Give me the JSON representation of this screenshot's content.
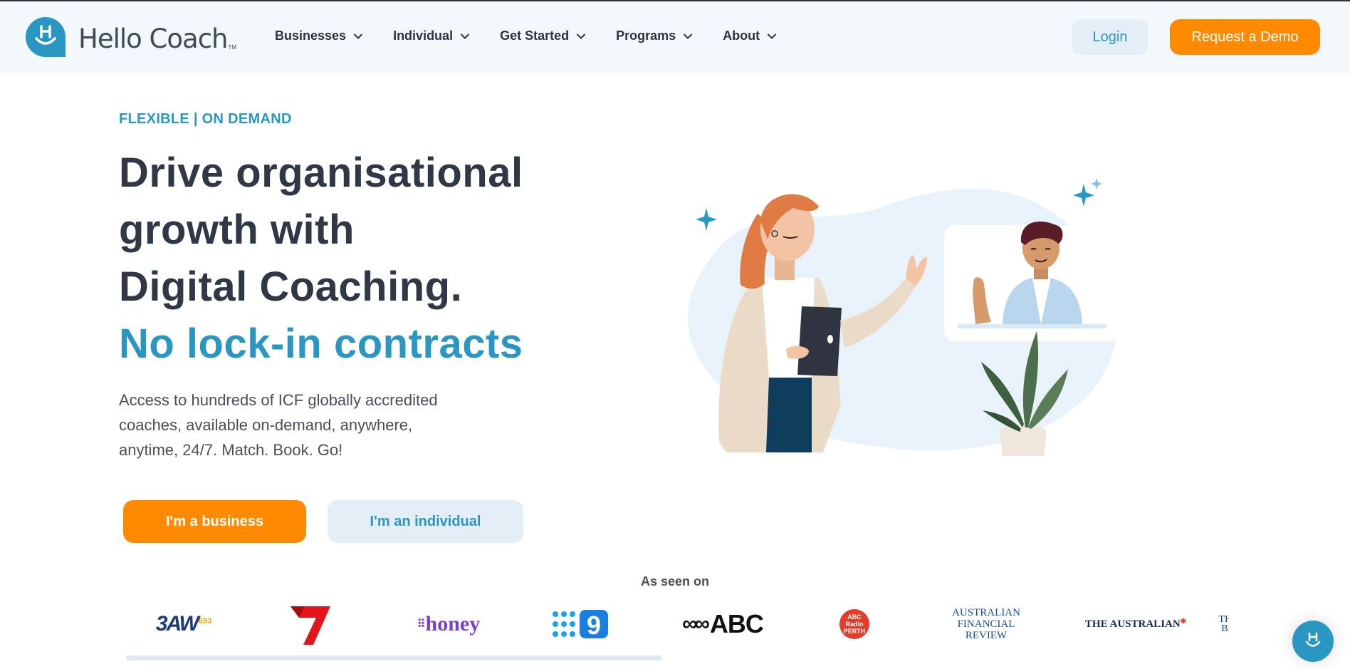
{
  "brand": {
    "name": "Hello Coach",
    "trademark": "TM",
    "logo_icon": "hello-coach-smile-icon",
    "primary_color": "#2a97c2",
    "accent_color": "#ff8a00"
  },
  "nav": {
    "items": [
      {
        "label": "Businesses"
      },
      {
        "label": "Individual"
      },
      {
        "label": "Get Started"
      },
      {
        "label": "Programs"
      },
      {
        "label": "About"
      }
    ],
    "login_label": "Login",
    "demo_label": "Request a Demo"
  },
  "hero": {
    "eyebrow": "FLEXIBLE | ON DEMAND",
    "headline_line1": "Drive organisational",
    "headline_line2": "growth with",
    "headline_line3": "Digital Coaching.",
    "headline_accent": "No lock-in contracts",
    "subtext": "Access to hundreds of ICF globally accredited coaches, available on-demand, anywhere, anytime, 24/7. Match. Book. Go!",
    "business_button": "I'm a business",
    "individual_button": "I'm an individual"
  },
  "seen_on": {
    "label": "As seen on",
    "logos": [
      {
        "name": "3AW 693",
        "text": "3AW",
        "sub": "693"
      },
      {
        "name": "Seven Network",
        "text": "7"
      },
      {
        "name": "honey",
        "text": "honey"
      },
      {
        "name": "Channel 9",
        "text": "9"
      },
      {
        "name": "ABC",
        "text": "ABC"
      },
      {
        "name": "ABC Radio Perth",
        "text": "ABC Radio PERTH"
      },
      {
        "name": "Australian Financial Review",
        "line1": "AUSTRALIAN",
        "line2": "FINANCIAL REVIEW"
      },
      {
        "name": "The Australian",
        "text": "THE AUSTRALIAN"
      },
      {
        "name": "Business (cut off)",
        "line1": "THE",
        "line2": "BU"
      }
    ]
  },
  "chat": {
    "icon": "chat-helper-icon"
  }
}
